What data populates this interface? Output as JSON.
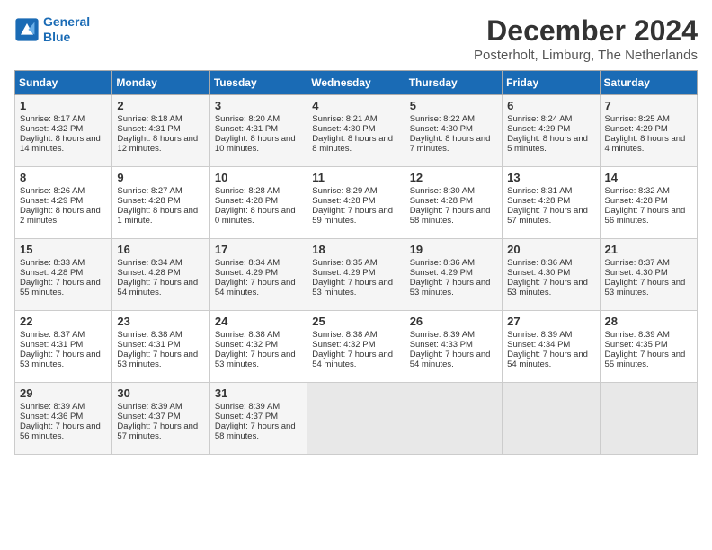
{
  "logo": {
    "line1": "General",
    "line2": "Blue"
  },
  "title": "December 2024",
  "location": "Posterholt, Limburg, The Netherlands",
  "headers": [
    "Sunday",
    "Monday",
    "Tuesday",
    "Wednesday",
    "Thursday",
    "Friday",
    "Saturday"
  ],
  "weeks": [
    [
      {
        "day": "1",
        "sunrise": "Sunrise: 8:17 AM",
        "sunset": "Sunset: 4:32 PM",
        "daylight": "Daylight: 8 hours and 14 minutes."
      },
      {
        "day": "2",
        "sunrise": "Sunrise: 8:18 AM",
        "sunset": "Sunset: 4:31 PM",
        "daylight": "Daylight: 8 hours and 12 minutes."
      },
      {
        "day": "3",
        "sunrise": "Sunrise: 8:20 AM",
        "sunset": "Sunset: 4:31 PM",
        "daylight": "Daylight: 8 hours and 10 minutes."
      },
      {
        "day": "4",
        "sunrise": "Sunrise: 8:21 AM",
        "sunset": "Sunset: 4:30 PM",
        "daylight": "Daylight: 8 hours and 8 minutes."
      },
      {
        "day": "5",
        "sunrise": "Sunrise: 8:22 AM",
        "sunset": "Sunset: 4:30 PM",
        "daylight": "Daylight: 8 hours and 7 minutes."
      },
      {
        "day": "6",
        "sunrise": "Sunrise: 8:24 AM",
        "sunset": "Sunset: 4:29 PM",
        "daylight": "Daylight: 8 hours and 5 minutes."
      },
      {
        "day": "7",
        "sunrise": "Sunrise: 8:25 AM",
        "sunset": "Sunset: 4:29 PM",
        "daylight": "Daylight: 8 hours and 4 minutes."
      }
    ],
    [
      {
        "day": "8",
        "sunrise": "Sunrise: 8:26 AM",
        "sunset": "Sunset: 4:29 PM",
        "daylight": "Daylight: 8 hours and 2 minutes."
      },
      {
        "day": "9",
        "sunrise": "Sunrise: 8:27 AM",
        "sunset": "Sunset: 4:28 PM",
        "daylight": "Daylight: 8 hours and 1 minute."
      },
      {
        "day": "10",
        "sunrise": "Sunrise: 8:28 AM",
        "sunset": "Sunset: 4:28 PM",
        "daylight": "Daylight: 8 hours and 0 minutes."
      },
      {
        "day": "11",
        "sunrise": "Sunrise: 8:29 AM",
        "sunset": "Sunset: 4:28 PM",
        "daylight": "Daylight: 7 hours and 59 minutes."
      },
      {
        "day": "12",
        "sunrise": "Sunrise: 8:30 AM",
        "sunset": "Sunset: 4:28 PM",
        "daylight": "Daylight: 7 hours and 58 minutes."
      },
      {
        "day": "13",
        "sunrise": "Sunrise: 8:31 AM",
        "sunset": "Sunset: 4:28 PM",
        "daylight": "Daylight: 7 hours and 57 minutes."
      },
      {
        "day": "14",
        "sunrise": "Sunrise: 8:32 AM",
        "sunset": "Sunset: 4:28 PM",
        "daylight": "Daylight: 7 hours and 56 minutes."
      }
    ],
    [
      {
        "day": "15",
        "sunrise": "Sunrise: 8:33 AM",
        "sunset": "Sunset: 4:28 PM",
        "daylight": "Daylight: 7 hours and 55 minutes."
      },
      {
        "day": "16",
        "sunrise": "Sunrise: 8:34 AM",
        "sunset": "Sunset: 4:28 PM",
        "daylight": "Daylight: 7 hours and 54 minutes."
      },
      {
        "day": "17",
        "sunrise": "Sunrise: 8:34 AM",
        "sunset": "Sunset: 4:29 PM",
        "daylight": "Daylight: 7 hours and 54 minutes."
      },
      {
        "day": "18",
        "sunrise": "Sunrise: 8:35 AM",
        "sunset": "Sunset: 4:29 PM",
        "daylight": "Daylight: 7 hours and 53 minutes."
      },
      {
        "day": "19",
        "sunrise": "Sunrise: 8:36 AM",
        "sunset": "Sunset: 4:29 PM",
        "daylight": "Daylight: 7 hours and 53 minutes."
      },
      {
        "day": "20",
        "sunrise": "Sunrise: 8:36 AM",
        "sunset": "Sunset: 4:30 PM",
        "daylight": "Daylight: 7 hours and 53 minutes."
      },
      {
        "day": "21",
        "sunrise": "Sunrise: 8:37 AM",
        "sunset": "Sunset: 4:30 PM",
        "daylight": "Daylight: 7 hours and 53 minutes."
      }
    ],
    [
      {
        "day": "22",
        "sunrise": "Sunrise: 8:37 AM",
        "sunset": "Sunset: 4:31 PM",
        "daylight": "Daylight: 7 hours and 53 minutes."
      },
      {
        "day": "23",
        "sunrise": "Sunrise: 8:38 AM",
        "sunset": "Sunset: 4:31 PM",
        "daylight": "Daylight: 7 hours and 53 minutes."
      },
      {
        "day": "24",
        "sunrise": "Sunrise: 8:38 AM",
        "sunset": "Sunset: 4:32 PM",
        "daylight": "Daylight: 7 hours and 53 minutes."
      },
      {
        "day": "25",
        "sunrise": "Sunrise: 8:38 AM",
        "sunset": "Sunset: 4:32 PM",
        "daylight": "Daylight: 7 hours and 54 minutes."
      },
      {
        "day": "26",
        "sunrise": "Sunrise: 8:39 AM",
        "sunset": "Sunset: 4:33 PM",
        "daylight": "Daylight: 7 hours and 54 minutes."
      },
      {
        "day": "27",
        "sunrise": "Sunrise: 8:39 AM",
        "sunset": "Sunset: 4:34 PM",
        "daylight": "Daylight: 7 hours and 54 minutes."
      },
      {
        "day": "28",
        "sunrise": "Sunrise: 8:39 AM",
        "sunset": "Sunset: 4:35 PM",
        "daylight": "Daylight: 7 hours and 55 minutes."
      }
    ],
    [
      {
        "day": "29",
        "sunrise": "Sunrise: 8:39 AM",
        "sunset": "Sunset: 4:36 PM",
        "daylight": "Daylight: 7 hours and 56 minutes."
      },
      {
        "day": "30",
        "sunrise": "Sunrise: 8:39 AM",
        "sunset": "Sunset: 4:37 PM",
        "daylight": "Daylight: 7 hours and 57 minutes."
      },
      {
        "day": "31",
        "sunrise": "Sunrise: 8:39 AM",
        "sunset": "Sunset: 4:37 PM",
        "daylight": "Daylight: 7 hours and 58 minutes."
      },
      null,
      null,
      null,
      null
    ]
  ]
}
